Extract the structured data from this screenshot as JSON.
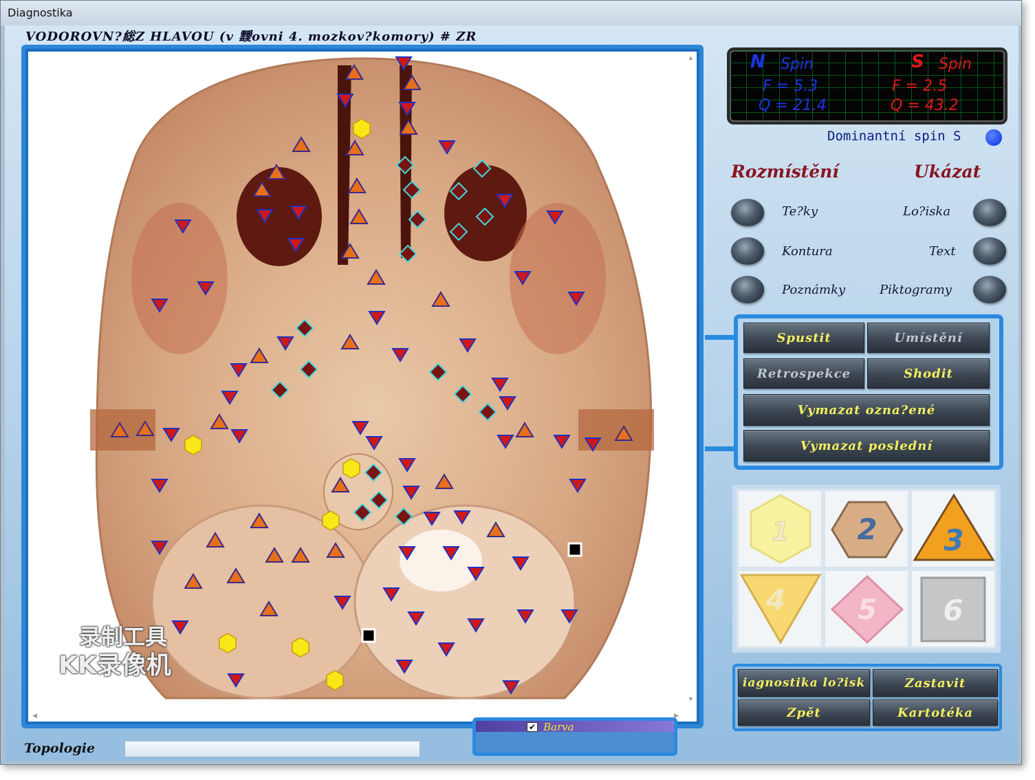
{
  "window": {
    "title": "Diagnostika"
  },
  "scan_title": "VODOROVN?総Z HLAVOU (v 靉ovni 4. mozkov?komory) # ZR",
  "spin": {
    "n_label": "N",
    "n_spin": "Spin",
    "n_f": "F = 5.3",
    "n_q": "Q = 21.4",
    "s_label": "S",
    "s_spin": "Spin",
    "s_f": "F = 2.5",
    "s_q": "Q = 43.2"
  },
  "dominant_spin": "Dominantní spin S",
  "colors": {
    "accent": "#2a8ae0",
    "dominant_dot": "#0a2ee0",
    "n_color": "#1a35e0",
    "s_color": "#e01818"
  },
  "headers": {
    "placement": "Rozmístění",
    "show": "Ukázat"
  },
  "toggles_left": [
    {
      "label": "Te?ky"
    },
    {
      "label": "Kontura"
    },
    {
      "label": "Poznámky"
    }
  ],
  "toggles_right": [
    {
      "label": "Lo?iska"
    },
    {
      "label": "Text"
    },
    {
      "label": "Piktogramy"
    }
  ],
  "commands": {
    "start": "Spustit",
    "placement": "Umístění",
    "retrospect": "Retrospekce",
    "drop": "Shodit",
    "clear_marked": "Vymazat ozna?ené",
    "clear_last": "Vymazat poslední"
  },
  "shapes": [
    {
      "number": "1",
      "icon": "hexagon-yellow-icon"
    },
    {
      "number": "2",
      "icon": "hexagon-tan-icon"
    },
    {
      "number": "3",
      "icon": "triangle-orange-icon"
    },
    {
      "number": "4",
      "icon": "triangle-down-yellow-icon"
    },
    {
      "number": "5",
      "icon": "diamond-pink-icon"
    },
    {
      "number": "6",
      "icon": "square-gray-icon"
    }
  ],
  "bottom_buttons": {
    "diag": "iagnostika lo?isk",
    "stop": "Zastavit",
    "back": "Zpět",
    "cards": "Kartotéka"
  },
  "topologie_label": "Topologie",
  "barva": {
    "label": "Barva",
    "checked": true
  },
  "watermark": {
    "line1": "录制工具",
    "line2": "KK录像机"
  }
}
